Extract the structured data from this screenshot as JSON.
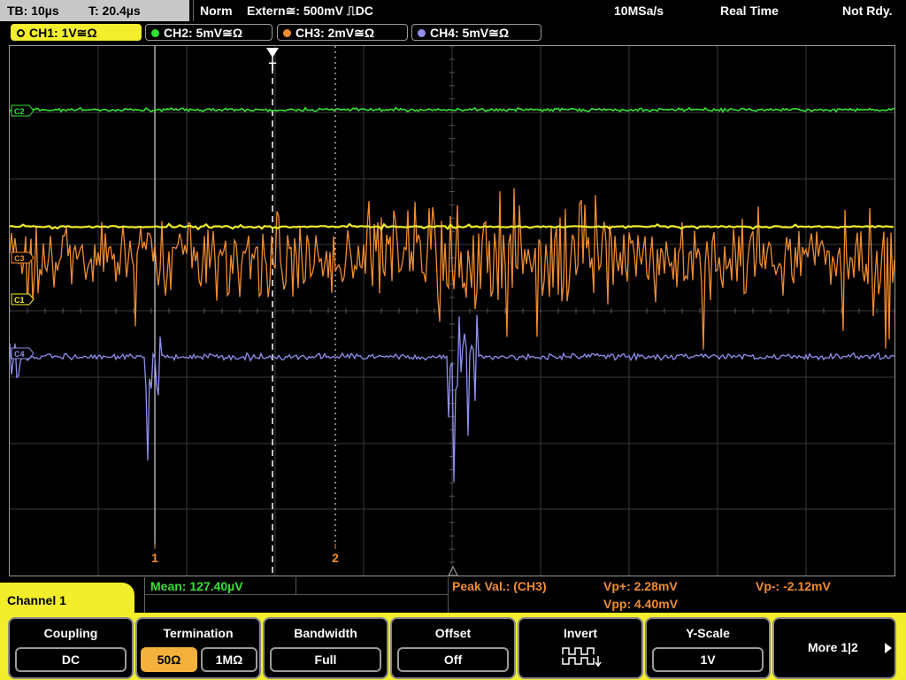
{
  "topbar": {
    "timebase": "TB: 10µs",
    "trigger_time": "T: 20.4µs",
    "trigger_mode": "Norm",
    "trigger_source": "Extern≅: 500mV ⎍DC",
    "sample_rate": "10MSa/s",
    "acq_mode": "Real Time",
    "status": "Not Rdy."
  },
  "channels": [
    {
      "label": "CH1: 1V≅Ω",
      "color": "#f2ee2c",
      "active": true
    },
    {
      "label": "CH2: 5mV≅Ω",
      "color": "#35e035",
      "active": false
    },
    {
      "label": "CH3: 2mV≅Ω",
      "color": "#f08c30",
      "active": false
    },
    {
      "label": "CH4: 5mV≅Ω",
      "color": "#9090f0",
      "active": false
    }
  ],
  "markers": {
    "trigger_label": "T",
    "cursor1_label": "1",
    "cursor2_label": "2",
    "ch1_ref": "C1",
    "ch2_ref": "C2",
    "ch3_ref": "C3",
    "ch4_ref": "C4"
  },
  "measurements": {
    "mean": "Mean: 127.40µV",
    "peak_label": "Peak Val.:  (CH3)",
    "vp_plus": "Vp+: 2.28mV",
    "vp_minus": "Vp-: -2.12mV",
    "vpp": "Vpp: 4.40mV",
    "mean_color": "#35e035",
    "peak_color": "#f08c30"
  },
  "menu_title": "Channel 1",
  "softkeys": {
    "coupling": {
      "title": "Coupling",
      "value": "DC"
    },
    "termination": {
      "title": "Termination",
      "opt1": "50Ω",
      "opt2": "1MΩ",
      "selected": "50Ω"
    },
    "bandwidth": {
      "title": "Bandwidth",
      "value": "Full"
    },
    "offset": {
      "title": "Offset",
      "value": "Off"
    },
    "invert": {
      "title": "Invert"
    },
    "yscale": {
      "title": "Y-Scale",
      "value": "1V"
    },
    "more": {
      "label": "More 1|2"
    }
  },
  "colors": {
    "ch1": "#f2ee2c",
    "ch2": "#35e035",
    "ch3": "#f08c30",
    "ch4": "#9090f0",
    "menu_bg": "#f2ee2c",
    "selected_option": "#f4b23c"
  }
}
